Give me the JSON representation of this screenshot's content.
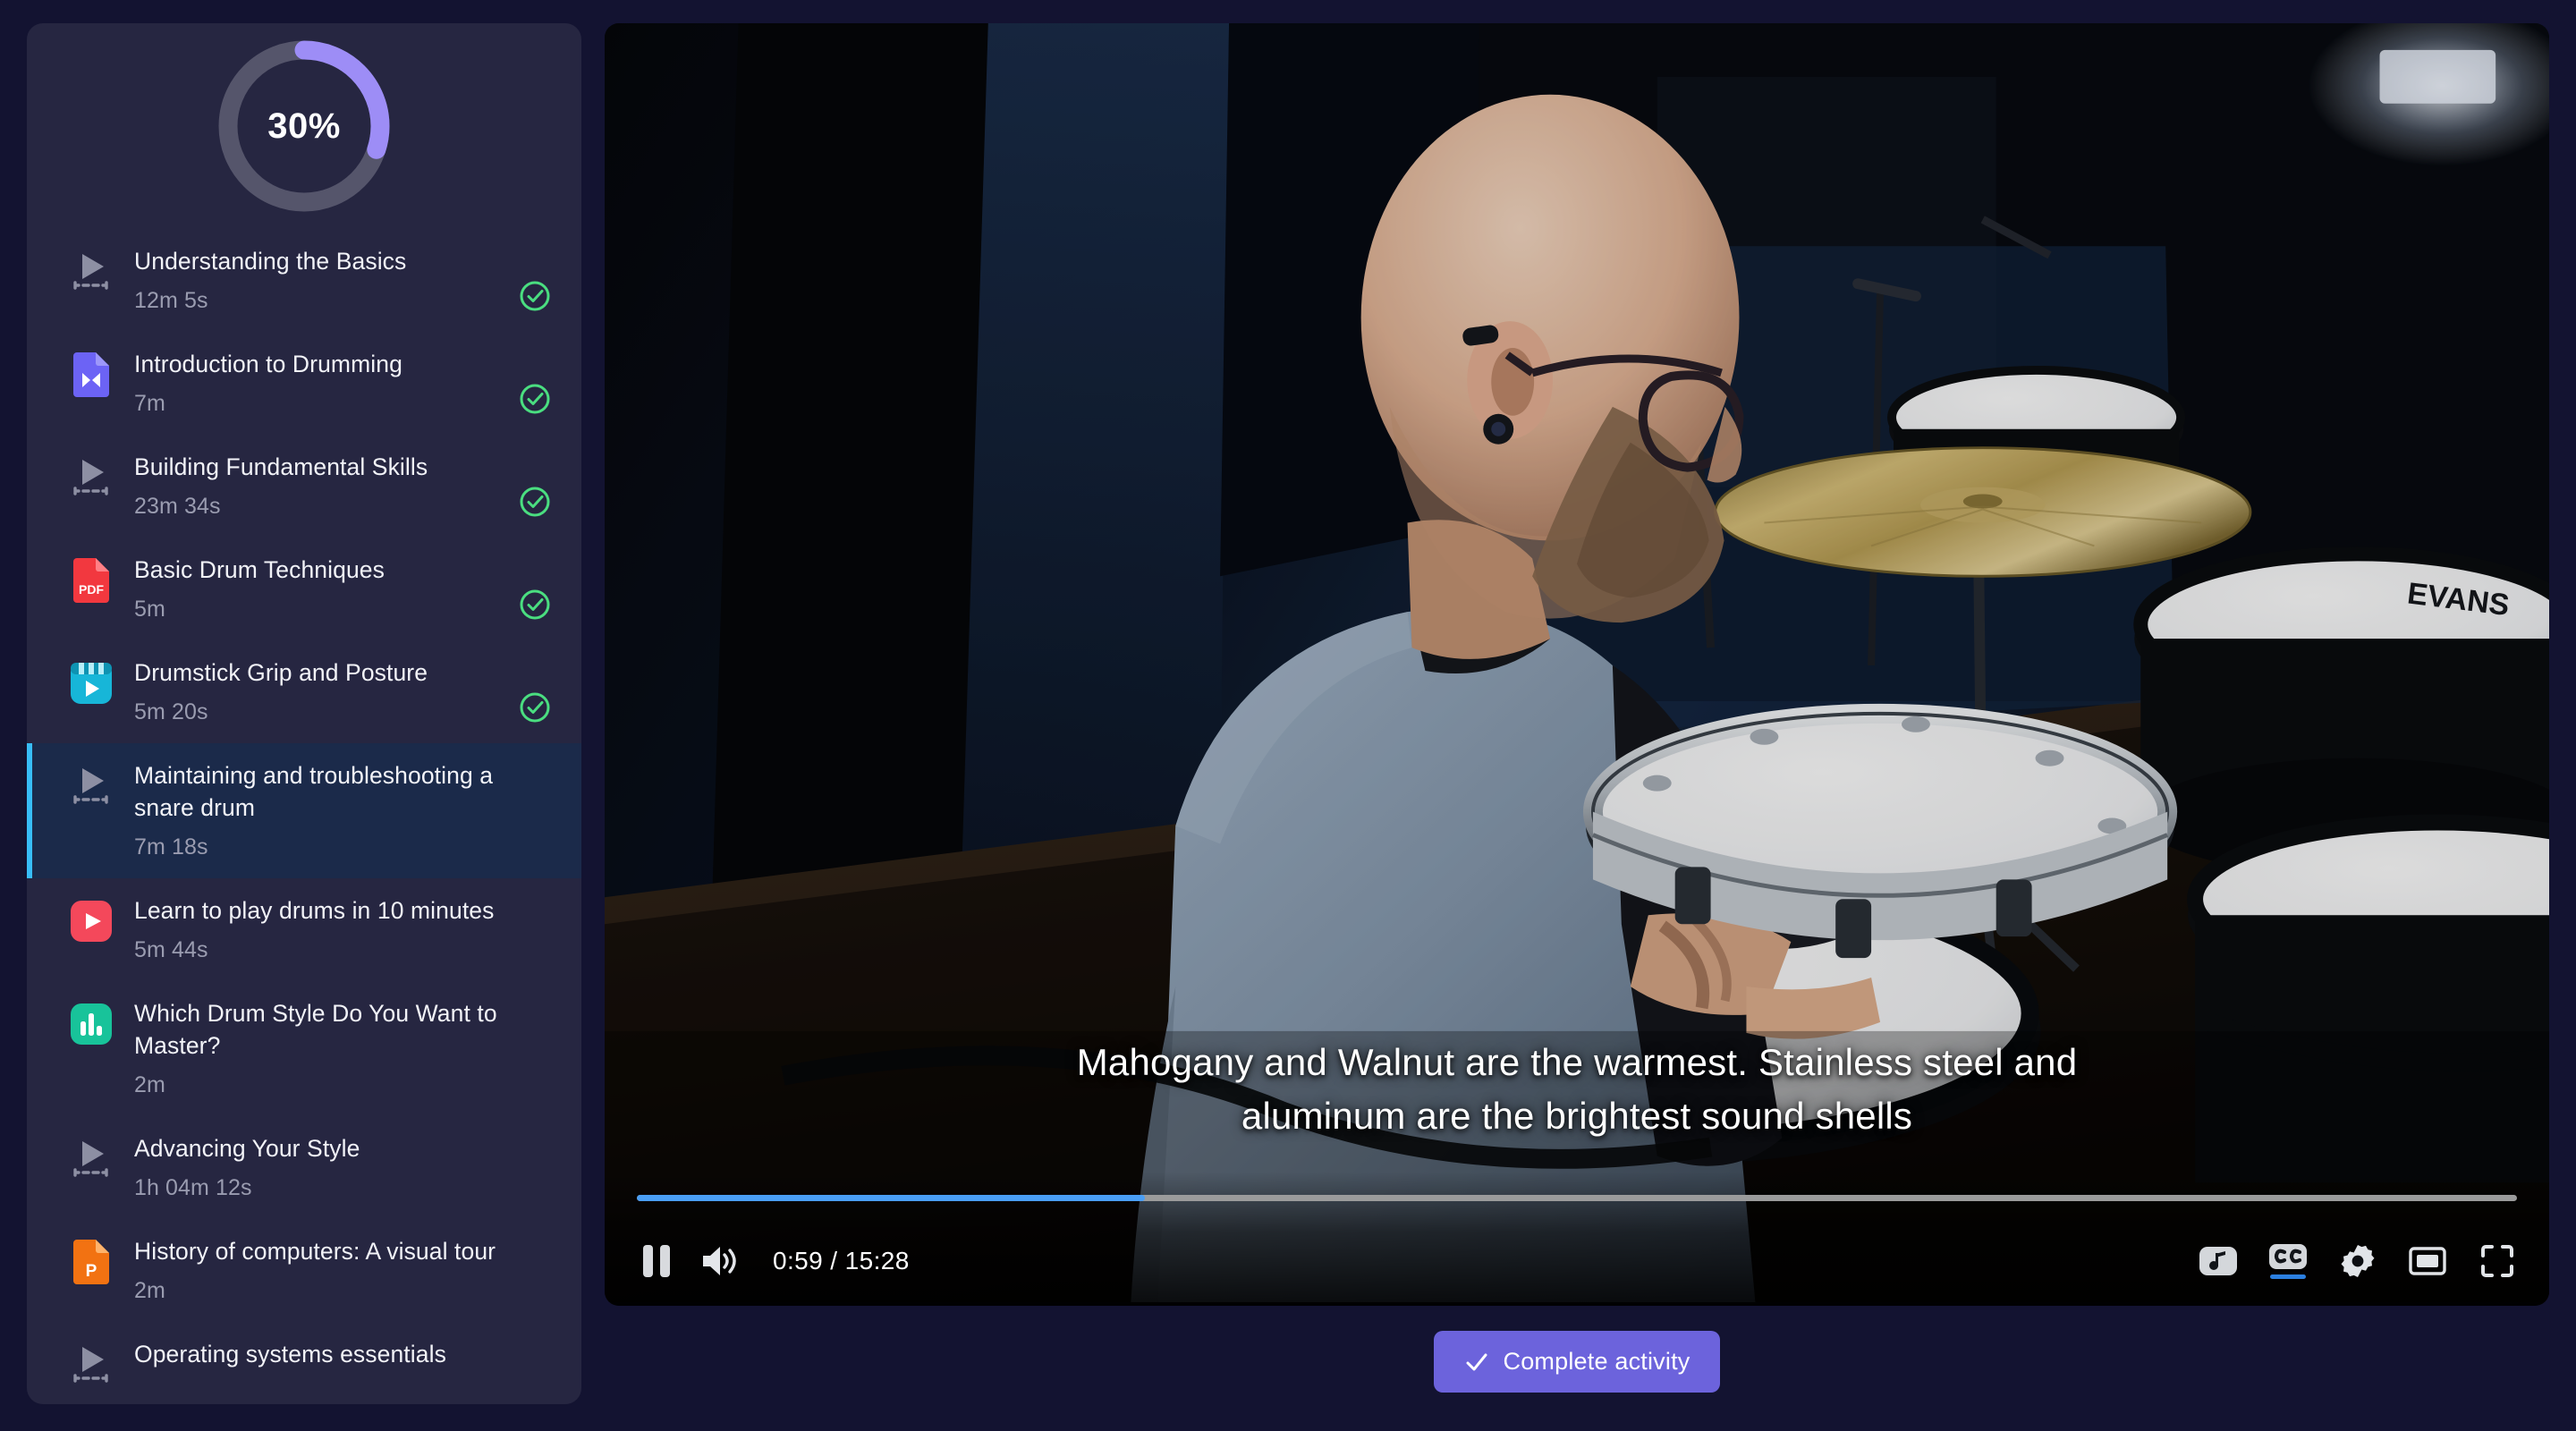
{
  "sidebar": {
    "progress": {
      "percent": 30,
      "label": "30%",
      "track_color": "#55556B",
      "arc_color": "#9D8DF6"
    },
    "lessons": [
      {
        "title": "Understanding the Basics",
        "duration": "12m 5s",
        "icon": "video-placeholder-icon",
        "completed": true,
        "active": false
      },
      {
        "title": "Introduction to Drumming",
        "duration": "7m",
        "icon": "video-file-icon",
        "completed": true,
        "active": false
      },
      {
        "title": "Building Fundamental Skills",
        "duration": "23m 34s",
        "icon": "video-placeholder-icon",
        "completed": true,
        "active": false
      },
      {
        "title": "Basic Drum Techniques",
        "duration": "5m",
        "icon": "pdf-file-icon",
        "completed": true,
        "active": false
      },
      {
        "title": "Drumstick Grip and Posture",
        "duration": "5m 20s",
        "icon": "scorm-package-icon",
        "completed": true,
        "active": false
      },
      {
        "title": "Maintaining and troubleshooting a snare drum",
        "duration": "7m 18s",
        "icon": "video-placeholder-icon",
        "completed": false,
        "active": true
      },
      {
        "title": "Learn to play drums in 10 minutes",
        "duration": "5m 44s",
        "icon": "youtube-video-icon",
        "completed": false,
        "active": false
      },
      {
        "title": "Which Drum Style Do You Want to Master?",
        "duration": "2m",
        "icon": "survey-icon",
        "completed": false,
        "active": false
      },
      {
        "title": "Advancing Your Style",
        "duration": "1h 04m 12s",
        "icon": "video-placeholder-icon",
        "completed": false,
        "active": false
      },
      {
        "title": "History of computers: A visual tour",
        "duration": "2m",
        "icon": "powerpoint-file-icon",
        "completed": false,
        "active": false
      },
      {
        "title": "Operating systems essentials",
        "duration": "",
        "icon": "video-placeholder-icon",
        "completed": false,
        "active": false
      }
    ],
    "completed_color": "#4ADE80",
    "active_border_color": "#38BDF8"
  },
  "player": {
    "caption": "Mahogany and Walnut are the warmest. Stainless steel and aluminum are the brightest sound shells",
    "time_display": "0:59 / 15:28",
    "current_time": "0:59",
    "total_time": "15:28",
    "progress_percent": 27,
    "play_state": "playing",
    "pause_label": "Pause",
    "volume_label": "Mute",
    "audio_track_label": "Audio track",
    "captions_label": "Subtitles/closed captions",
    "captions_active": true,
    "settings_label": "Settings",
    "miniplayer_label": "Miniplayer",
    "fullscreen_label": "Full screen",
    "seek_fill_color": "#4A9EF5",
    "drum_brand_text": "EVANS"
  },
  "footer": {
    "complete_button_label": "Complete activity",
    "complete_button_color": "#6C63DC"
  }
}
